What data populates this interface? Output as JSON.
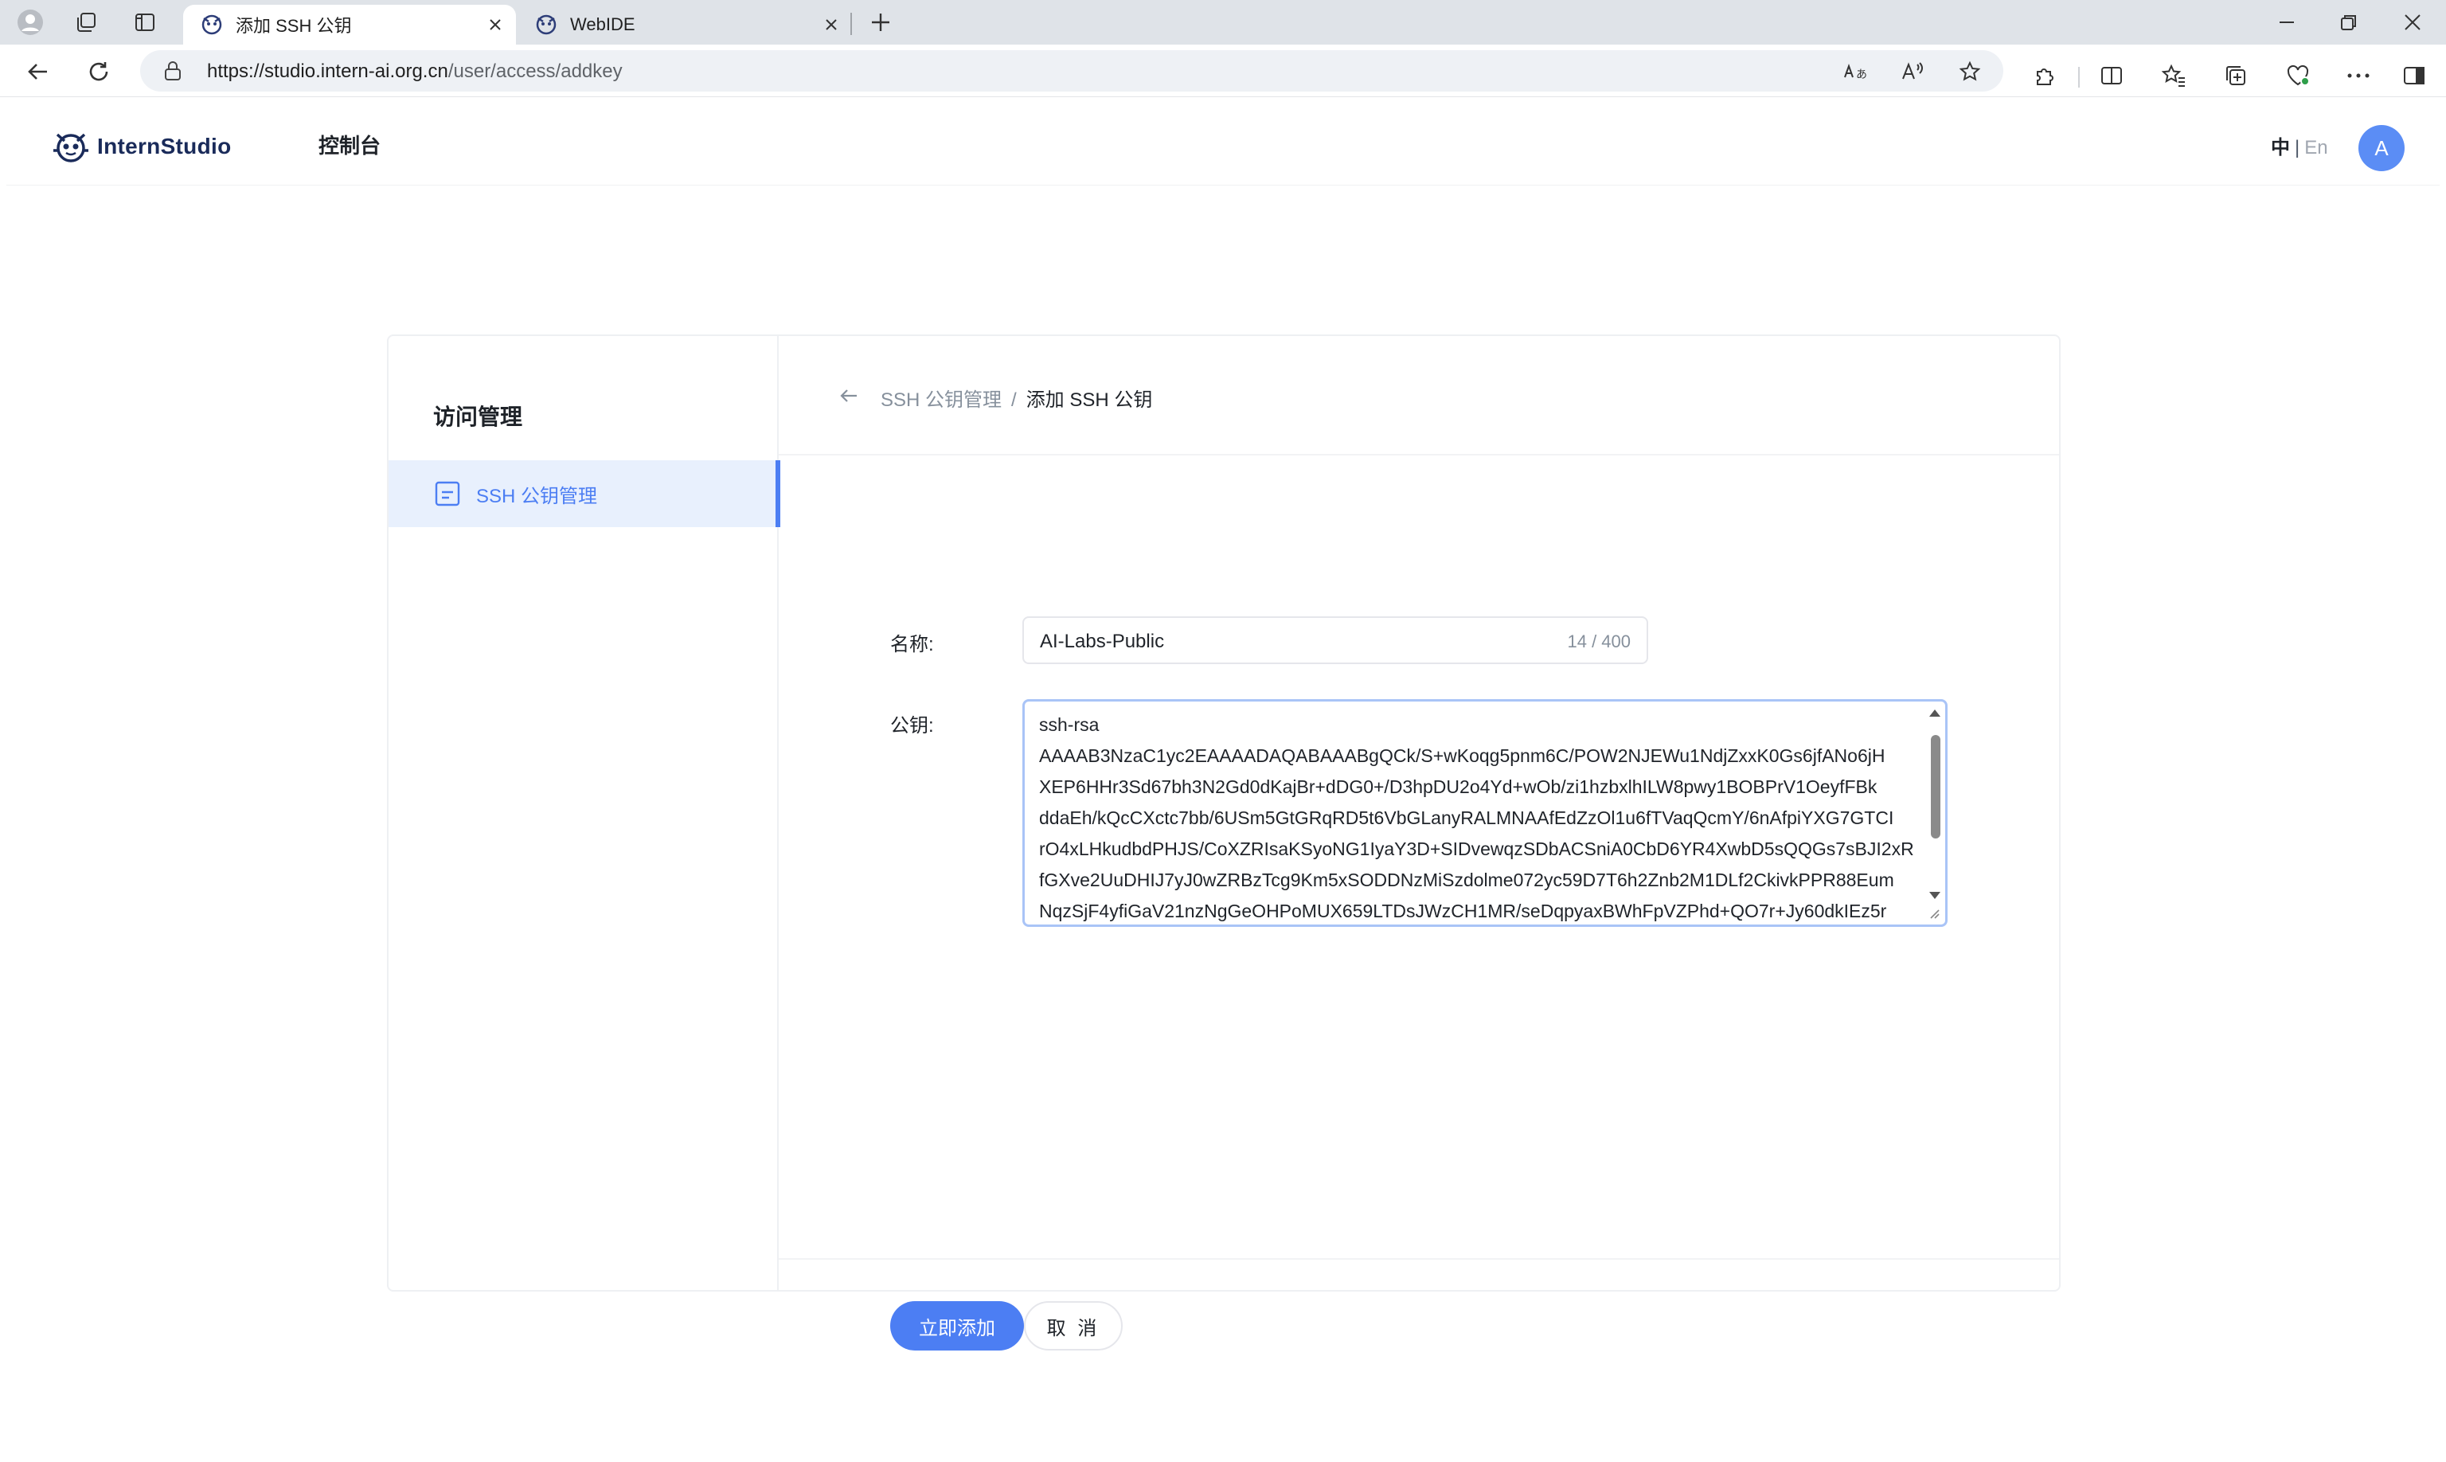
{
  "browser": {
    "tabs": [
      {
        "title": "添加 SSH 公钥",
        "active": true
      },
      {
        "title": "WebIDE",
        "active": false
      }
    ],
    "url_host": "https://studio.intern-ai.org.cn",
    "url_path": "/user/access/addkey"
  },
  "header": {
    "brand": "InternStudio",
    "console": "控制台",
    "lang_zh": "中",
    "lang_sep": "|",
    "lang_en": "En",
    "avatar_letter": "A"
  },
  "sidebar": {
    "title": "访问管理",
    "items": [
      {
        "label": "SSH 公钥管理",
        "selected": true
      }
    ]
  },
  "breadcrumb": {
    "parent": "SSH 公钥管理",
    "separator": "/",
    "current": "添加 SSH 公钥"
  },
  "form": {
    "name_label": "名称:",
    "name_value": "AI-Labs-Public",
    "name_count": "14 / 400",
    "key_label": "公钥:",
    "key_value": "ssh-rsa\nAAAAB3NzaC1yc2EAAAADAQABAAABgQCk/S+wKoqg5pnm6C/POW2NJEWu1NdjZxxK0Gs6jfANo6jH\nXEP6HHr3Sd67bh3N2Gd0dKajBr+dDG0+/D3hpDU2o4Yd+wOb/zi1hzbxlhILW8pwy1BOBPrV1OeyfFBk\nddaEh/kQcCXctc7bb/6USm5GtGRqRD5t6VbGLanyRALMNAAfEdZzOl1u6fTVaqQcmY/6nAfpiYXG7GTCI\nrO4xLHkudbdPHJS/CoXZRIsaKSyoNG1IyaY3D+SIDvewqzSDbACSniA0CbD6YR4XwbD5sQQGs7sBJI2xR\nfGXve2UuDHIJ7yJ0wZRBzTcg9Km5xSODDNzMiSzdolme072yc59D7T6h2Znb2M1DLf2CkivkPPR88Eum\nNqzSjF4yfiGaV21nzNgGeOHPoMUX659LTDsJWzCH1MR/seDqpyaxBWhFpVZPhd+QO7r+Jy60dkIEz5r"
  },
  "actions": {
    "submit": "立即添加",
    "cancel": "取 消"
  },
  "colors": {
    "primary": "#4c7ef3",
    "selected_bg": "#e8f0fd",
    "tabbar_bg": "#dfe3e8"
  }
}
